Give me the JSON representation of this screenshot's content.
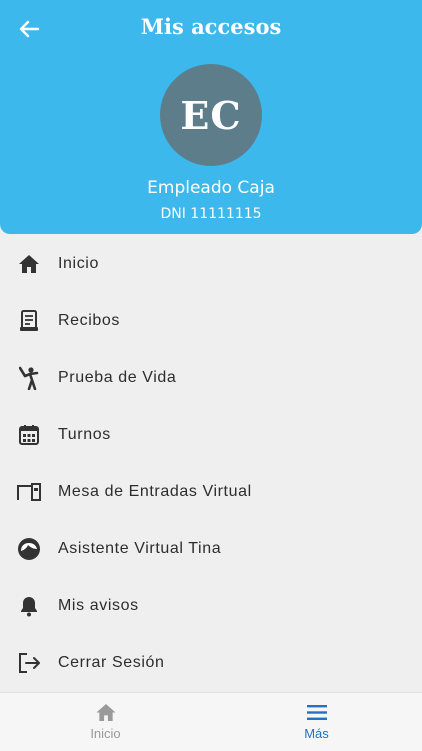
{
  "header": {
    "title": "Mis accesos",
    "avatar_initials": "EC",
    "user_name": "Empleado Caja",
    "user_dni": "DNI 11111115",
    "background_color": "#3db8ec"
  },
  "menu": {
    "items": [
      {
        "label": "Inicio",
        "icon": "home-icon"
      },
      {
        "label": "Recibos",
        "icon": "receipt-icon"
      },
      {
        "label": "Prueba de Vida",
        "icon": "person-wave-icon"
      },
      {
        "label": "Turnos",
        "icon": "calendar-icon"
      },
      {
        "label": "Mesa de Entradas Virtual",
        "icon": "inbox-tray-icon"
      },
      {
        "label": "Asistente Virtual Tina",
        "icon": "assistant-face-icon"
      },
      {
        "label": "Mis avisos",
        "icon": "bell-icon"
      },
      {
        "label": "Cerrar Sesión",
        "icon": "logout-icon"
      }
    ]
  },
  "tabbar": {
    "tabs": [
      {
        "label": "Inicio",
        "icon": "home-icon",
        "active": false
      },
      {
        "label": "Más",
        "icon": "menu-icon",
        "active": true
      }
    ],
    "active_color": "#1f73c2",
    "inactive_color": "#9a9a9a"
  }
}
